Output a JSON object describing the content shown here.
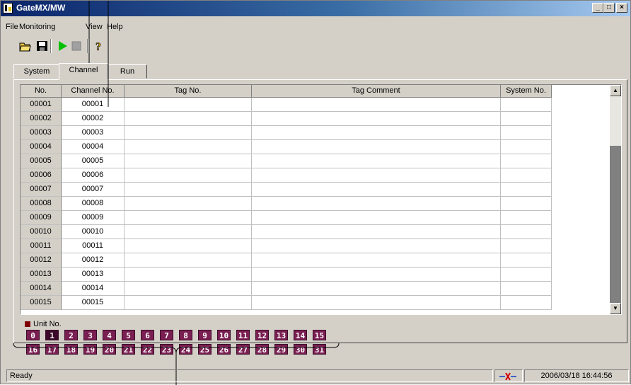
{
  "window": {
    "title": "GateMX/MW",
    "min_label": "_",
    "max_label": "□",
    "close_label": "×"
  },
  "menu": [
    "File",
    "Monitoring",
    "View",
    "Help"
  ],
  "toolbar": {
    "icons": [
      "open-folder-icon",
      "save-icon",
      "play-icon",
      "stop-icon",
      "help-icon"
    ]
  },
  "tabs": [
    {
      "label": "System"
    },
    {
      "label": "Channel",
      "active": true
    },
    {
      "label": "Run"
    }
  ],
  "table": {
    "headers": [
      "No.",
      "Channel No.",
      "Tag No.",
      "Tag Comment",
      "System No."
    ],
    "rows": [
      [
        "00001",
        "00001",
        "",
        "",
        ""
      ],
      [
        "00002",
        "00002",
        "",
        "",
        ""
      ],
      [
        "00003",
        "00003",
        "",
        "",
        ""
      ],
      [
        "00004",
        "00004",
        "",
        "",
        ""
      ],
      [
        "00005",
        "00005",
        "",
        "",
        ""
      ],
      [
        "00006",
        "00006",
        "",
        "",
        ""
      ],
      [
        "00007",
        "00007",
        "",
        "",
        ""
      ],
      [
        "00008",
        "00008",
        "",
        "",
        ""
      ],
      [
        "00009",
        "00009",
        "",
        "",
        ""
      ],
      [
        "00010",
        "00010",
        "",
        "",
        ""
      ],
      [
        "00011",
        "00011",
        "",
        "",
        ""
      ],
      [
        "00012",
        "00012",
        "",
        "",
        ""
      ],
      [
        "00013",
        "00013",
        "",
        "",
        ""
      ],
      [
        "00014",
        "00014",
        "",
        "",
        ""
      ],
      [
        "00015",
        "00015",
        "",
        "",
        ""
      ]
    ]
  },
  "unit_section": {
    "label": "Unit No.",
    "units": [
      "0",
      "1",
      "2",
      "3",
      "4",
      "5",
      "6",
      "7",
      "8",
      "9",
      "10",
      "11",
      "12",
      "13",
      "14",
      "15",
      "16",
      "17",
      "18",
      "19",
      "20",
      "21",
      "22",
      "23",
      "24",
      "25",
      "26",
      "27",
      "28",
      "29",
      "30",
      "31"
    ],
    "selected_unit": "1"
  },
  "statusbar": {
    "status": "Ready",
    "timestamp": "2006/03/18 16:44:56"
  },
  "colors": {
    "accent": "#0a246a",
    "unit_fill": "#7a1f52",
    "play": "#00c000"
  }
}
